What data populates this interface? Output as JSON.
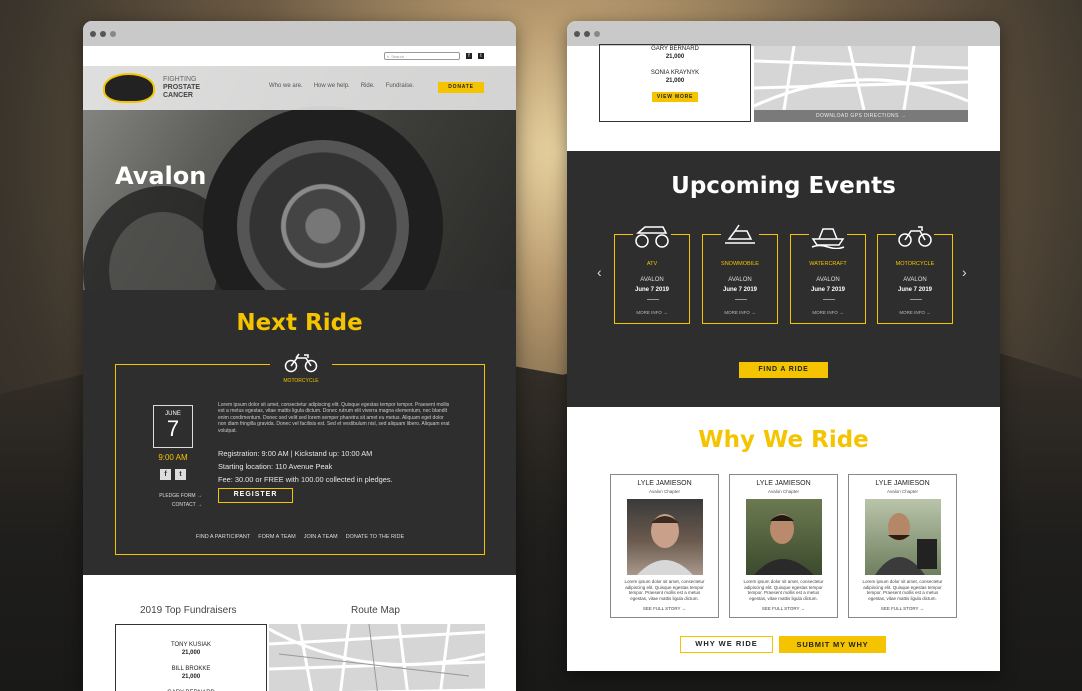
{
  "site": {
    "search_placeholder": "Search",
    "logo_text_line1": "FIGHTING",
    "logo_text_line2": "PROSTATE",
    "logo_text_line3": "CANCER",
    "nav": [
      "Who we are.",
      "How we help.",
      "Ride.",
      "Fundraise."
    ],
    "donate_label": "DONATE",
    "hero_title": "Avalon"
  },
  "next_ride": {
    "title": "Next Ride",
    "type": "MOTORCYCLE",
    "month": "JUNE",
    "day": "7",
    "time": "9:00 AM",
    "description": "Lorem ipsum dolor sit amet, consectetur adipiscing elit. Quisque egestas tempor tempor. Praesent mollis est a metus egestas, vitae mattis ligula dictum. Donec rutrum elit viverra magna elementum, nec blandit enim condimentum. Donec sed velit sed lorem semper pharetra sit amet eu metus. Aliquam eget dolor non diam fringilla gravida. Donec vel facilisis est. Sed et vestibulum nisl, sed aliquam libero. Aliquam erat volutpat.",
    "registration": "Registration: 9:00 AM   |   Kickstand up: 10:00 AM",
    "location": "Starting location: 110 Avenue Peak",
    "fee": "Fee: 30.00 or FREE with 100.00 collected in pledges.",
    "pledge_link": "PLEDGE FORM →",
    "contact_link": "CONTACT →",
    "register_label": "REGISTER",
    "links": [
      "FIND A PARTICIPANT",
      "FORM A TEAM",
      "JOIN A TEAM",
      "DONATE TO THE RIDE"
    ]
  },
  "fundraisers": {
    "title": "2019 Top Fundraisers",
    "map_title": "Route Map",
    "people": [
      {
        "name": "TONY KUSIAK",
        "amount": "21,000"
      },
      {
        "name": "BILL BROKKE",
        "amount": "21,000"
      },
      {
        "name": "GARY BERNARD",
        "amount": "21,000"
      },
      {
        "name": "SONIA KRAYNYK",
        "amount": "21,000"
      }
    ],
    "view_more": "VIEW MORE",
    "gps": "DOWNLOAD GPS DIRECTIONS →"
  },
  "events": {
    "title": "Upcoming Events",
    "items": [
      {
        "type": "ATV",
        "location": "AVALON",
        "date": "June 7 2019",
        "more": "MORE INFO →",
        "icon": "atv-icon"
      },
      {
        "type": "SNOWMOBILE",
        "location": "AVALON",
        "date": "June 7 2019",
        "more": "MORE INFO →",
        "icon": "snowmobile-icon"
      },
      {
        "type": "WATERCRAFT",
        "location": "AVALON",
        "date": "June 7 2019",
        "more": "MORE INFO →",
        "icon": "watercraft-icon"
      },
      {
        "type": "MOTORCYCLE",
        "location": "AVALON",
        "date": "June 7 2019",
        "more": "MORE INFO →",
        "icon": "motorcycle-icon"
      }
    ],
    "find_label": "FIND A RIDE"
  },
  "why": {
    "title": "Why We Ride",
    "people": [
      {
        "name": "LYLE JAMIESON",
        "chapter": "Avalon Chapter",
        "text": "Lorem ipsum dolor sit amet, consectetur adipiscing elit. Quisque egestas tempor tempor. Praesent mollis est a metus egestas, vitae mattis ligula dictum.",
        "link": "SEE FULL STORY →"
      },
      {
        "name": "LYLE JAMIESON",
        "chapter": "Avalon Chapter",
        "text": "Lorem ipsum dolor sit amet, consectetur adipiscing elit. Quisque egestas tempor tempor. Praesent mollis est a metus egestas, vitae mattis ligula dictum.",
        "link": "SEE FULL STORY →"
      },
      {
        "name": "LYLE JAMIESON",
        "chapter": "Avalon Chapter",
        "text": "Lorem ipsum dolor sit amet, consectetur adipiscing elit. Quisque egestas tempor tempor. Praesent mollis est a metus egestas, vitae mattis ligula dictum.",
        "link": "SEE FULL STORY →"
      }
    ],
    "why_btn": "WHY WE RIDE",
    "submit_btn": "SUBMIT MY WHY"
  },
  "colors": {
    "accent": "#f5c400",
    "dark": "#2e2e2e"
  }
}
